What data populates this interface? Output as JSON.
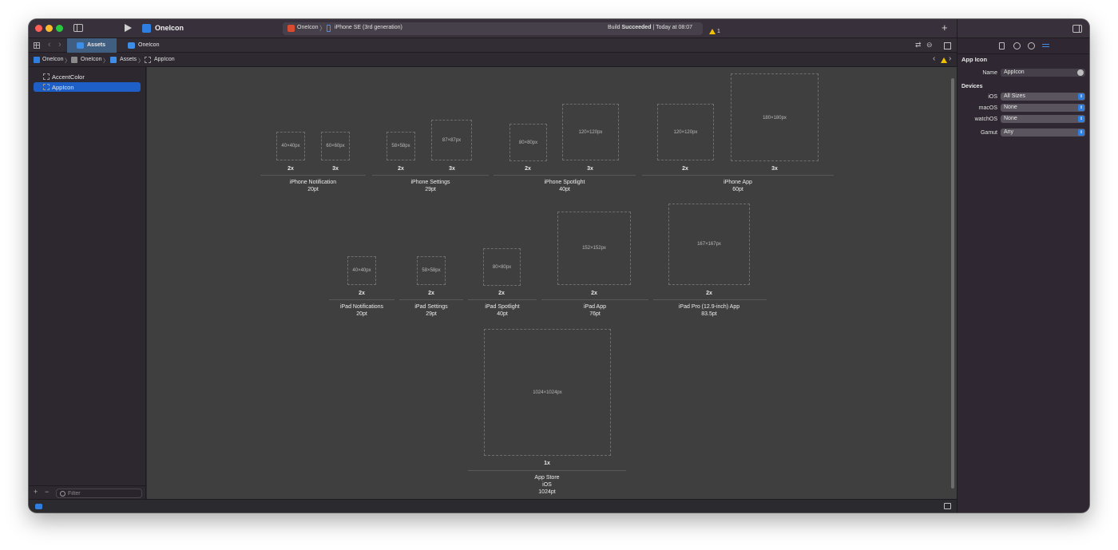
{
  "titlebar": {
    "project_name": "OneIcon",
    "scheme_target": "OneIcon",
    "scheme_device": "iPhone SE (3rd generation)",
    "build_status_prefix": "Build ",
    "build_status_bold": "Succeeded",
    "build_status_suffix": " | Today at 08:07",
    "warning_count": "1",
    "add_label": "+"
  },
  "tabs": [
    {
      "label": "Assets",
      "active": true
    },
    {
      "label": "OneIcon",
      "active": false
    }
  ],
  "breadcrumb": [
    "OneIcon",
    "OneIcon",
    "Assets",
    "AppIcon"
  ],
  "navigator": {
    "items": [
      {
        "label": "AccentColor",
        "selected": false
      },
      {
        "label": "AppIcon",
        "selected": true
      }
    ],
    "filter_placeholder": "Filter"
  },
  "iphone_groups": [
    {
      "title": "iPhone Notification",
      "size": "20pt",
      "slots": [
        {
          "px": "40×40px",
          "scale": "2x"
        },
        {
          "px": "60×60px",
          "scale": "3x"
        }
      ]
    },
    {
      "title": "iPhone Settings",
      "size": "29pt",
      "slots": [
        {
          "px": "58×58px",
          "scale": "2x"
        },
        {
          "px": "87×87px",
          "scale": "3x"
        }
      ]
    },
    {
      "title": "iPhone Spotlight",
      "size": "40pt",
      "slots": [
        {
          "px": "80×80px",
          "scale": "2x"
        },
        {
          "px": "120×120px",
          "scale": "3x"
        }
      ]
    },
    {
      "title": "iPhone App",
      "size": "60pt",
      "slots": [
        {
          "px": "120×120px",
          "scale": "2x"
        },
        {
          "px": "180×180px",
          "scale": "3x"
        }
      ]
    }
  ],
  "ipad_groups": [
    {
      "title": "iPad Notifications",
      "size": "20pt",
      "slots": [
        {
          "px": "40×40px",
          "scale": "2x"
        }
      ]
    },
    {
      "title": "iPad Settings",
      "size": "29pt",
      "slots": [
        {
          "px": "58×58px",
          "scale": "2x"
        }
      ]
    },
    {
      "title": "iPad Spotlight",
      "size": "40pt",
      "slots": [
        {
          "px": "80×80px",
          "scale": "2x"
        }
      ]
    },
    {
      "title": "iPad App",
      "size": "76pt",
      "slots": [
        {
          "px": "152×152px",
          "scale": "2x"
        }
      ]
    },
    {
      "title": "iPad Pro (12.9-inch) App",
      "size": "83.5pt",
      "slots": [
        {
          "px": "167×167px",
          "scale": "2x"
        }
      ]
    }
  ],
  "app_store": {
    "title": "App Store",
    "platform": "iOS",
    "size": "1024pt",
    "px": "1024×1024px",
    "scale": "1x"
  },
  "inspector": {
    "section_title": "App Icon",
    "name_label": "Name",
    "name_value": "AppIcon",
    "devices_title": "Devices",
    "ios_label": "iOS",
    "ios_value": "All Sizes",
    "macos_label": "macOS",
    "macos_value": "None",
    "watchos_label": "watchOS",
    "watchos_value": "None",
    "gamut_label": "Gamut",
    "gamut_value": "Any"
  },
  "colors": {
    "accent": "#1e5fc7",
    "warning": "#f2c200",
    "canvas": "#3f3f3f"
  }
}
